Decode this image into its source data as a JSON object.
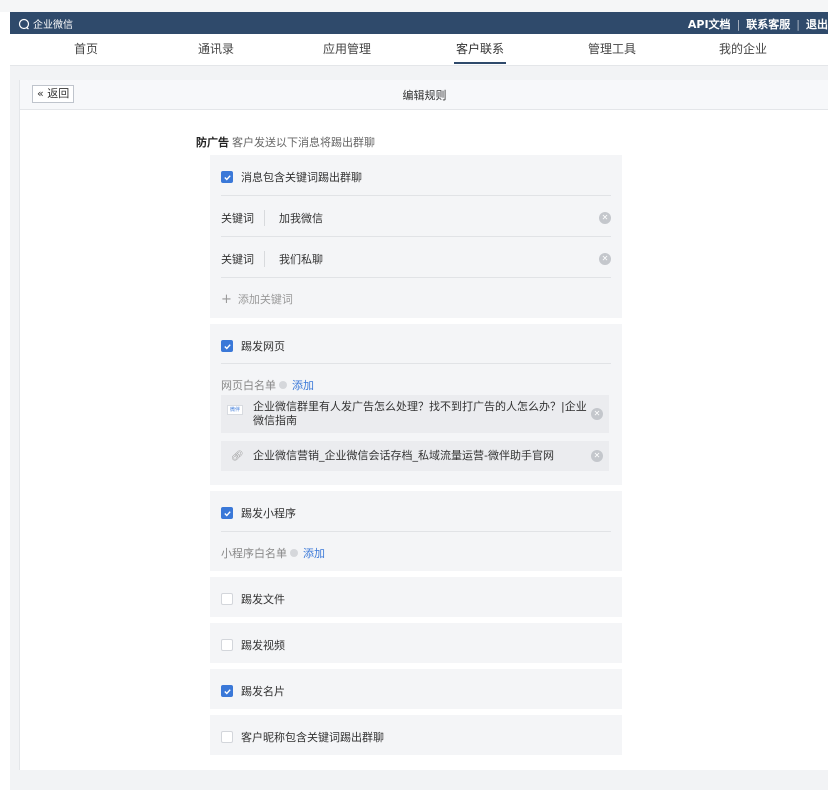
{
  "topbar": {
    "brand": "企业微信",
    "links": [
      "API文档",
      "联系客服",
      "退出"
    ]
  },
  "nav": {
    "items": [
      "首页",
      "通讯录",
      "应用管理",
      "客户联系",
      "管理工具",
      "我的企业"
    ],
    "active_index": 3
  },
  "panel": {
    "back_label": "« 返回",
    "title": "编辑规则"
  },
  "section": {
    "title": "防广告",
    "subtitle": "客户发送以下消息将踢出群聊"
  },
  "keyword_card": {
    "checkbox_label": "消息包含关键词踢出群聊",
    "checked": true,
    "keyword_label": "关键词",
    "keywords": [
      "加我微信",
      "我们私聊"
    ],
    "add_label": "添加关键词"
  },
  "webpage_card": {
    "checkbox_label": "踢发网页",
    "checked": true,
    "whitelist_label": "网页白名单",
    "add_link": "添加",
    "items": [
      {
        "icon": "page-thumb-icon",
        "thumb_text": "微伴",
        "text": "企业微信群里有人发广告怎么处理？找不到打广告的人怎么办？|企业微信指南"
      },
      {
        "icon": "link-icon",
        "text": "企业微信营销_企业微信会话存档_私域流量运营-微伴助手官网"
      }
    ]
  },
  "miniprogram_card": {
    "checkbox_label": "踢发小程序",
    "checked": true,
    "whitelist_label": "小程序白名单",
    "add_link": "添加"
  },
  "simple_cards": [
    {
      "label": "踢发文件",
      "checked": false
    },
    {
      "label": "踢发视频",
      "checked": false
    },
    {
      "label": "踢发名片",
      "checked": true
    },
    {
      "label": "客户昵称包含关键词踢出群聊",
      "checked": false
    }
  ],
  "colors": {
    "topbar": "#2f4a6b",
    "accent": "#3a78d8",
    "card_bg": "#f4f5f7"
  }
}
